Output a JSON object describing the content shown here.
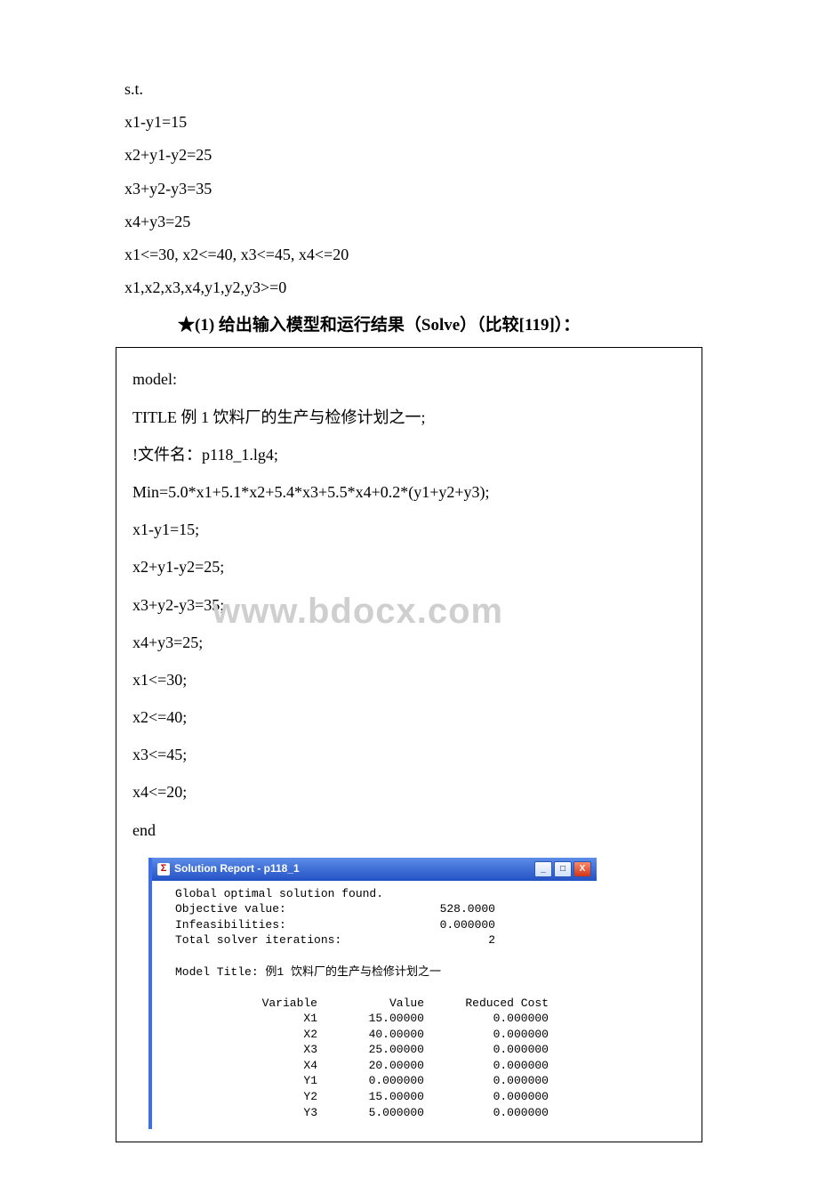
{
  "problem": {
    "st": "s.t.",
    "eq1": "x1-y1=15",
    "eq2": "x2+y1-y2=25",
    "eq3": "x3+y2-y3=35",
    "eq4": "x4+y3=25",
    "bounds": "x1<=30, x2<=40, x3<=45, x4<=20",
    "nonneg": "x1,x2,x3,x4,y1,y2,y3>=0"
  },
  "section_title": "★(1) 给出输入模型和运行结果（Solve）（比较[119]）：",
  "model": {
    "l0": "model:",
    "l1": "TITLE 例 1 饮料厂的生产与检修计划之一;",
    "l2": "!文件名：p118_1.lg4;",
    "l3": "Min=5.0*x1+5.1*x2+5.4*x3+5.5*x4+0.2*(y1+y2+y3);",
    "l4": "x1-y1=15;",
    "l5": "x2+y1-y2=25;",
    "l6": "x3+y2-y3=35;",
    "l7": "x4+y3=25;",
    "l8": "x1<=30;",
    "l9": "x2<=40;",
    "l10": "x3<=45;",
    "l11": "x4<=20;",
    "l12": "end"
  },
  "watermark": "www.bdocx.com",
  "solver": {
    "title": "Solution Report - p118_1",
    "found": "Global optimal solution found.",
    "obj_label": "Objective value:",
    "obj_value": "528.0000",
    "infeas_label": "Infeasibilities:",
    "infeas_value": "0.000000",
    "iters_label": "Total solver iterations:",
    "iters_value": "2",
    "model_title": "Model Title: 例1 饮料厂的生产与检修计划之一",
    "hdr_var": "Variable",
    "hdr_val": "Value",
    "hdr_rc": "Reduced Cost",
    "rows": [
      {
        "var": "X1",
        "val": "15.00000",
        "rc": "0.000000"
      },
      {
        "var": "X2",
        "val": "40.00000",
        "rc": "0.000000"
      },
      {
        "var": "X3",
        "val": "25.00000",
        "rc": "0.000000"
      },
      {
        "var": "X4",
        "val": "20.00000",
        "rc": "0.000000"
      },
      {
        "var": "Y1",
        "val": "0.000000",
        "rc": "0.000000"
      },
      {
        "var": "Y2",
        "val": "15.00000",
        "rc": "0.000000"
      },
      {
        "var": "Y3",
        "val": "5.000000",
        "rc": "0.000000"
      }
    ]
  },
  "icons": {
    "sigma": "Σ",
    "min": "_",
    "max": "□",
    "close": "X"
  }
}
